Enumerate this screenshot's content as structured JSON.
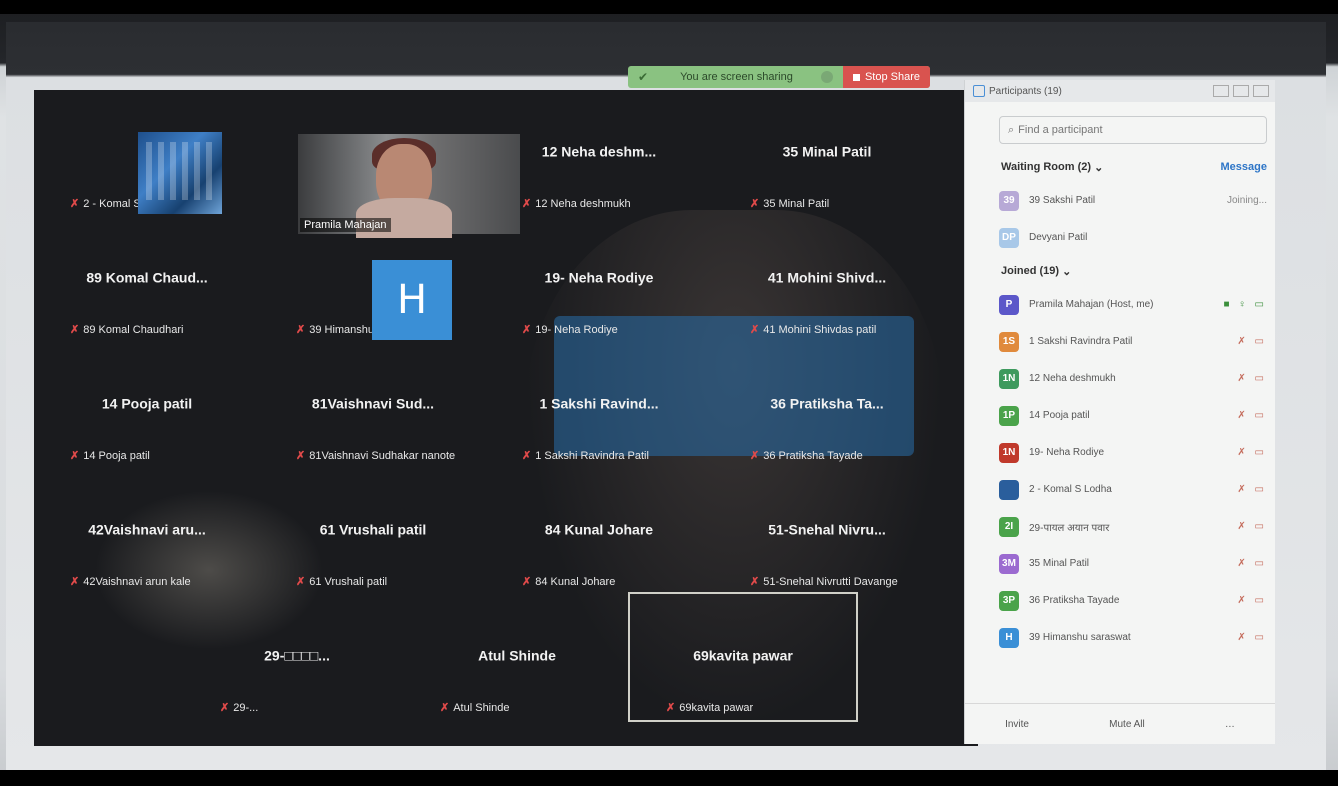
{
  "share_banner": {
    "message": "You are screen sharing",
    "stop_label": "Stop Share"
  },
  "gallery": {
    "tiles": [
      {
        "center": "",
        "label": "2 - Komal  S  Lodha",
        "muted": true
      },
      {
        "center": "",
        "label": "Pramila Mahajan",
        "muted": false
      },
      {
        "center": "12 Neha deshm...",
        "label": "12 Neha deshmukh",
        "muted": true
      },
      {
        "center": "35 Minal Patil",
        "label": "35 Minal Patil",
        "muted": true
      },
      {
        "center": "89 Komal Chaud...",
        "label": "89 Komal Chaudhari",
        "muted": true
      },
      {
        "center": "",
        "label": "39 Himanshu saraswat",
        "muted": true
      },
      {
        "center": "19- Neha Rodiye",
        "label": "19- Neha Rodiye",
        "muted": true
      },
      {
        "center": "41 Mohini Shivd...",
        "label": "41 Mohini Shivdas patil",
        "muted": true
      },
      {
        "center": "14 Pooja patil",
        "label": "14 Pooja patil",
        "muted": true
      },
      {
        "center": "81Vaishnavi Sud...",
        "label": "81Vaishnavi Sudhakar nanote",
        "muted": true
      },
      {
        "center": "1 Sakshi Ravind...",
        "label": "1 Sakshi Ravindra Patil",
        "muted": true
      },
      {
        "center": "36 Pratiksha Ta...",
        "label": "36 Pratiksha Tayade",
        "muted": true
      },
      {
        "center": "42Vaishnavi aru...",
        "label": "42Vaishnavi arun kale",
        "muted": true
      },
      {
        "center": "61 Vrushali patil",
        "label": "61 Vrushali patil",
        "muted": true
      },
      {
        "center": "84 Kunal Johare",
        "label": "84 Kunal Johare",
        "muted": true
      },
      {
        "center": "51-Snehal  Nivru...",
        "label": "51-Snehal Nivrutti Davange",
        "muted": true
      },
      {
        "center": "29-□□□□...",
        "label": "29-...",
        "muted": true
      },
      {
        "center": "Atul Shinde",
        "label": "Atul Shinde",
        "muted": true
      },
      {
        "center": "69kavita pawar",
        "label": "69kavita pawar",
        "muted": true
      }
    ],
    "h_avatar_letter": "H",
    "pramila_name": "Pramila Mahajan"
  },
  "panel": {
    "title": "Participants (19)",
    "search_placeholder": "Find a participant",
    "waiting_header": "Waiting Room (2)",
    "message_label": "Message",
    "waiting": [
      {
        "initials": "39",
        "name": "39 Sakshi Patil",
        "status": "Joining...",
        "color": "#b7a9d6"
      },
      {
        "initials": "DP",
        "name": "Devyani Patil",
        "status": "",
        "color": "#a8c8e8"
      }
    ],
    "joined_header": "Joined (19)",
    "joined": [
      {
        "initials": "P",
        "name": "Pramila Mahajan (Host, me)",
        "color": "#5b57c9",
        "host": true
      },
      {
        "initials": "1S",
        "name": "1 Sakshi Ravindra Patil",
        "color": "#e08a3c",
        "host": false
      },
      {
        "initials": "1N",
        "name": "12 Neha deshmukh",
        "color": "#3e9a5e",
        "host": false
      },
      {
        "initials": "1P",
        "name": "14 Pooja patil",
        "color": "#4aa34a",
        "host": false
      },
      {
        "initials": "1N",
        "name": "19- Neha Rodiye",
        "color": "#c0392b",
        "host": false
      },
      {
        "initials": "",
        "name": "2 - Komal  S  Lodha",
        "color": "#2a5e9c",
        "host": false
      },
      {
        "initials": "2I",
        "name": "29-पायल अयान पवार",
        "color": "#4aa34a",
        "host": false
      },
      {
        "initials": "3M",
        "name": "35 Minal Patil",
        "color": "#9b6ad0",
        "host": false
      },
      {
        "initials": "3P",
        "name": "36 Pratiksha Tayade",
        "color": "#4aa34a",
        "host": false
      },
      {
        "initials": "H",
        "name": "39 Himanshu saraswat",
        "color": "#3a8fd6",
        "host": false
      }
    ],
    "invite_label": "Invite",
    "mute_all_label": "Mute All"
  }
}
